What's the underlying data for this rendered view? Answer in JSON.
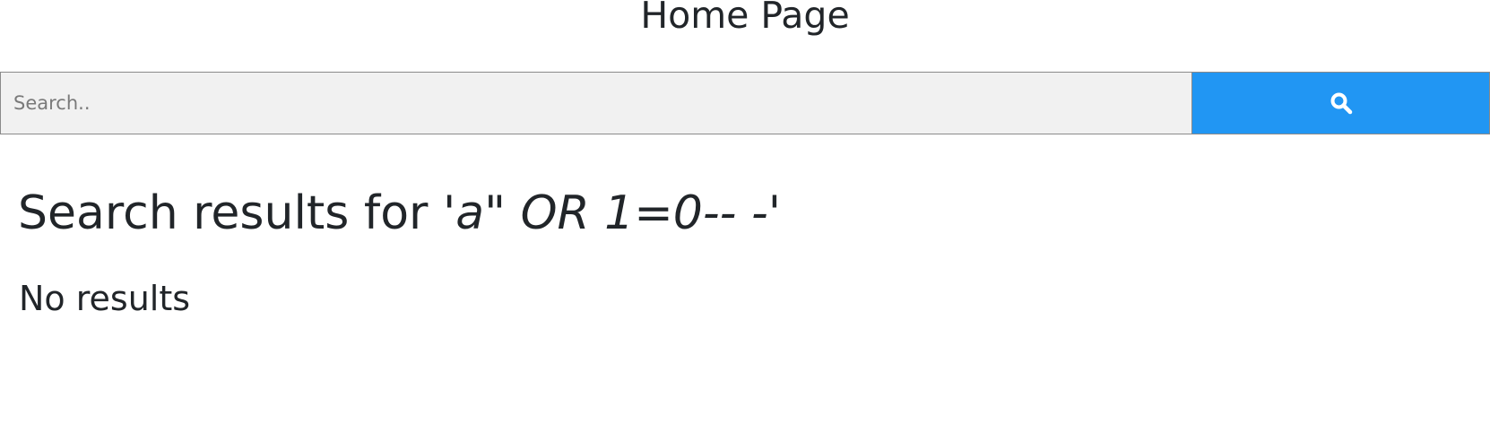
{
  "header": {
    "title": "Home Page"
  },
  "search": {
    "placeholder": "Search..",
    "value": "",
    "button_icon": "search-icon",
    "button_color": "#2196f3"
  },
  "results": {
    "heading_prefix": "Search results for '",
    "query": "a\" OR 1=0-- -",
    "heading_suffix": "'",
    "empty_message": "No results"
  }
}
